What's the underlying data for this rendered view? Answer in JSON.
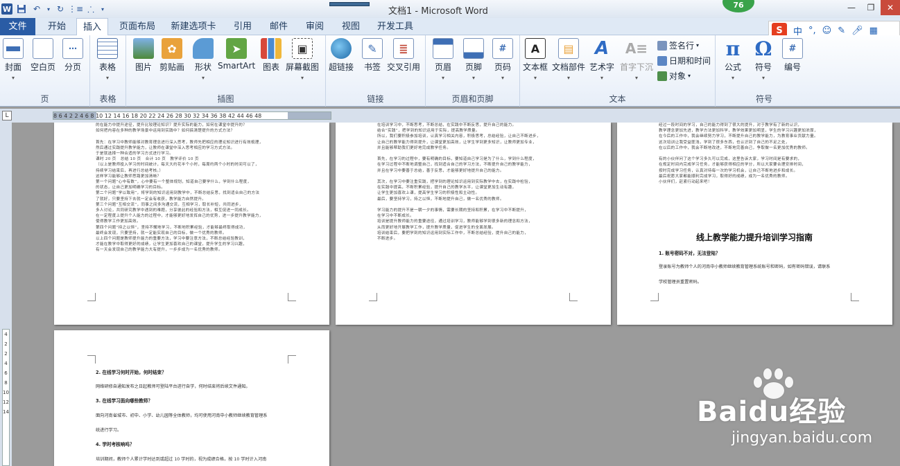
{
  "window": {
    "title": "文档1 - Microsoft Word",
    "badge": "76",
    "controls": [
      "—",
      "❐",
      "✕"
    ]
  },
  "qat": {
    "logo": "W",
    "save_icon": "save-icon",
    "undo_icon": "undo-icon",
    "redo_icon": "redo-icon"
  },
  "tabs": [
    "文件",
    "开始",
    "插入",
    "页面布局",
    "新建选项卡",
    "引用",
    "邮件",
    "审阅",
    "视图",
    "开发工具"
  ],
  "active_tab": "插入",
  "ime": {
    "logo": "S",
    "lang": "中",
    "punct": "°,",
    "icons": [
      "smiley-icon",
      "pen-icon",
      "mic-icon",
      "grid-icon"
    ]
  },
  "ribbon": {
    "groups": {
      "pages": {
        "label": "页",
        "buttons": [
          "封面",
          "空白页",
          "分页"
        ]
      },
      "tables": {
        "label": "表格",
        "buttons": [
          "表格"
        ]
      },
      "illustrations": {
        "label": "插图",
        "buttons": [
          "图片",
          "剪贴画",
          "形状",
          "SmartArt",
          "图表",
          "屏幕截图"
        ]
      },
      "links": {
        "label": "链接",
        "buttons": [
          "超链接",
          "书签",
          "交叉引用"
        ]
      },
      "header_footer": {
        "label": "页眉和页脚",
        "buttons": [
          "页眉",
          "页脚",
          "页码"
        ]
      },
      "text": {
        "label": "文本",
        "buttons": [
          "文本框",
          "文档部件",
          "艺术字",
          "首字下沉"
        ],
        "small": [
          "签名行",
          "日期和时间",
          "对象"
        ]
      },
      "symbols": {
        "label": "符号",
        "buttons": [
          "公式",
          "符号",
          "编号"
        ]
      }
    }
  },
  "ruler": {
    "ticks": "8 6 4 2      2 4 6 8 10 12 14 16 18 20 22 24 26 28 30 32 34 36 38      42 44 46 48",
    "corner": "L",
    "vticks": "4 2 2 4 6 8 10 12 14"
  },
  "pages": {
    "p1": "的在能力中提升途径，提升比较理论知识？提升实际的能力，如何在课堂中提升的？\n如何把内容在多种的教学场景中运用到实践中？如何搞清楚提升的方式方法？\n\n首先：在学习中教师能够对教育理念进行深入思考，教师先把相应的理论知识进行有效梳理，\n然后通过实践提升教学能力，让教师在课堂中深入思考相应的学习方式方法。\n于是就选择一种合适的学习方式进行学习。\n课时 20 页   总结 10 页   合计 10 页   教学评价 10 页\n（以上是教师投入学习的时间统计，每天大约花半个小时，每周约两个小时的时间可以了，\n持续学习结束后，再进行总结考核。）\n这样学习能够让教师思路更加清晰？\n第一个问题“心中有数”，心中要有一个整体规划，知道自己要学什么，学到什么程度，\n的状态，让自己更加明确学习的目标。\n第二个问题“学以致用”，将学到的知识运用到教学中，不断总结反思，找到适合自己的方法\n了就好，只要坚持下去就一定会有收获，教学能力自然提升。\n第三个问题“互相交流”，同事之间多沟通交流，互相学习，取长补短，共同进步，\n多人讨论，共同研究教学中遇到的难题，分享彼此的经验和方法，相互促进一同成长。\n在一定程度上提升个人能力的过程中，才能够更好地发挥自己的优势，进一步提升教学能力，\n使得教学工作更加高效。\n第四个问题“持之以恒”，坚持不懈地学习，不断地积累经验，才能够最终取得成功，\n最终会发现，只要坚持，就一定能实现自己的目标，做一个优秀的教师。\n以上四个问题是教师提升能力的重要方法，学习中要注意方法，不断总结经验教训，\n才能在教学中取得更好的成绩，让学生更加喜欢自己的课堂，提升学生的学习兴趣，\n有一天会发现自己的教学能力大有提升，一步步成为一名优秀的教师。",
    "p2": "在培训学习中，不断思考，不断总结，在实践中不断反思，提升自己的能力。\n结合“实践”，把学到的知识运用于实际，提高教学质量。\n所以，我们要积极参加培训，认真学习相关内容，积极思考，总结经验，让自己不断进步，\n让自己的教学能力得到提升，让课堂更加高效，让学生学到更多知识，让教师更加专业，\n并且能够帮助我们更好地完成教学任务。\n\n首先，在学习的过程中，要有明确的目标，要知道自己学习是为了什么，学到什么程度，\n在学习过程中不断地调整自己，找到适合自己的学习方法，不断提升自己的教学能力，\n并且在学习中要善于总结，善于反思，才能够更好地提升自己的能力。\n\n其次，在学习中要注重实践，把学到的理论知识运用到实际教学中去，在实践中检验，\n在实践中提高，不断积累经验，提升自己的教学水平，让课堂更加生动有趣，\n让学生更加喜欢上课，提高学生学习的积极性和主动性。\n最后，要坚持学习，持之以恒，不断地提升自己，做一名优秀的教师。\n\n学习能力的提升不是一朝一夕的事情，需要长期的坚持和积累，在学习中不断提升，\n在学习中不断成长。\n培训是提升教师能力的重要途径，通过培训学习，教师能够学到很多新的理念和方法，\n从而更好地开展教学工作，提升教学质量，促进学生的全面发展。\n培训结束后，要把学到的知识运用到实际工作中，不断总结经验，提升自己的能力，\n不断进步。",
    "p3": "经过一段时间的学习，自己的能力得到了很大的提升，对于教学有了新的认识，\n教学理念更加先进，教学方法更加科学，教学效果更加明显，学生的学习兴趣更加浓厚，\n在今后的工作中，我会继续努力学习，不断提升自己的教学能力，为教育事业贡献力量。\n这次培训让我受益匪浅，学到了很多东西，也认识到了自己的不足之处，\n在以后的工作中，我会不断地改进，不断地完善自己，争取做一名更加优秀的教师。\n\n有的小伙伴问了这个学习多久可以完成，这里告诉大家，学习时间是有要求的，\n在规定时间内完成学习任务，才能够获得相应的学分，所以大家要合理安排时间，\n按时完成学习任务，认真对待每一次的学习机会，让自己不断地进步和成长。\n最后祝愿大家都能顺利完成学习，取得好的成绩，成为一名优秀的教师。\n小伙伴们，赶紧行动起来吧！",
    "p3_title": "线上教学能力提升培训学习指南",
    "p3_s1": "1. 账号密码不对，无法登陆？",
    "p3_s1_p": "登录账号为教师个人的河南中小教师继续教育管理系统账号和密码，如有密码错误，请联系",
    "p3_s1_p2": "学校管理员重置密码。",
    "p4_s2": "2. 在线学习何时开始，何时结束？",
    "p4_s2_p": "网络研修自通知发布之日起教师可登陆平台进行自学，何时结束将后续文件通知。",
    "p4_s3": "3. 在线学习面向哪些教师？",
    "p4_s3_p": "面向河南省城市、初中、小学、幼儿园等全体教师，均可使用河南中小教师继续教育管理系",
    "p4_s3_p2": "统进行学习。",
    "p4_s4": "4. 学时考核响吗？",
    "p4_s4_p": "培训期间，教师个人累计学时达到或超过 10 学时的，视为成绩合格，按 10 学时计入河南"
  },
  "watermark": {
    "text1": "Baidu经验",
    "text2": "jingyan.baidu.com"
  },
  "colors": {
    "file_tab": "#2a5ca5",
    "ribbon_bg": "#e7eef8",
    "doc_bg": "#9b9b9b"
  }
}
